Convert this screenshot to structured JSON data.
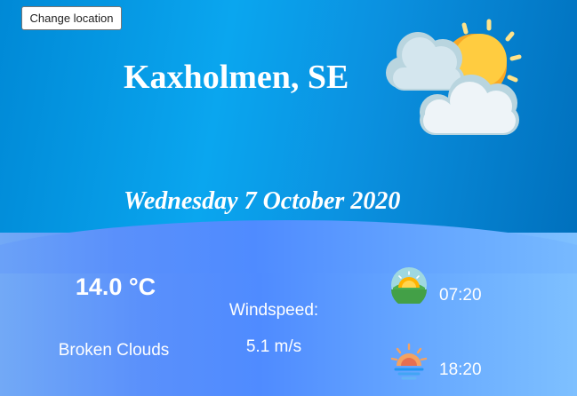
{
  "header": {
    "change_location_label": "Change location",
    "city": "Kaxholmen, SE",
    "date": "Wednesday 7 October 2020",
    "weather_icon": "partly-cloudy-icon"
  },
  "current": {
    "temperature": "14.0 °C",
    "description": "Broken Clouds"
  },
  "wind": {
    "label": "Windspeed:",
    "value": "5.1 m/s"
  },
  "sun": {
    "sunrise_icon": "sunrise-icon",
    "sunrise": "07:20",
    "sunset_icon": "sunset-icon",
    "sunset": "18:20"
  },
  "colors": {
    "header_blue": "#0aa6ef",
    "panel_blue": "#4f8bff",
    "sun_yellow": "#fbc02d",
    "cloud_white": "#eef4f8",
    "text": "#ffffff"
  }
}
